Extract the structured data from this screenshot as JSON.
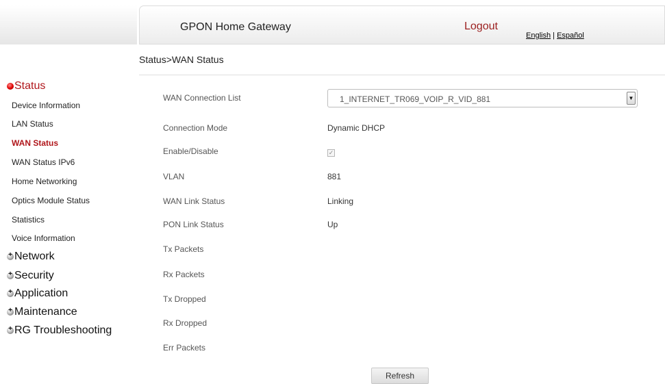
{
  "header": {
    "brand": "GPON Home Gateway",
    "logout": "Logout",
    "lang_english": "English",
    "lang_separator": "|",
    "lang_spanish": "Español"
  },
  "breadcrumb": "Status>WAN Status",
  "sidebar": {
    "status_section": "Status",
    "items": [
      {
        "label": "Device Information"
      },
      {
        "label": "LAN Status"
      },
      {
        "label": "WAN Status",
        "active": true
      },
      {
        "label": "WAN Status IPv6"
      },
      {
        "label": "Home Networking"
      },
      {
        "label": "Optics Module Status"
      },
      {
        "label": "Statistics"
      },
      {
        "label": "Voice Information"
      }
    ],
    "sections": [
      {
        "label": "Network"
      },
      {
        "label": "Security"
      },
      {
        "label": "Application"
      },
      {
        "label": "Maintenance"
      },
      {
        "label": "RG Troubleshooting"
      }
    ]
  },
  "form": {
    "connection_list_label": "WAN Connection List",
    "connection_list_value": "1_INTERNET_TR069_VOIP_R_VID_881",
    "connection_mode_label": "Connection Mode",
    "connection_mode_value": "Dynamic DHCP",
    "enable_label": "Enable/Disable",
    "enable_checked": true,
    "vlan_label": "VLAN",
    "vlan_value": "881",
    "wan_link_label": "WAN Link Status",
    "wan_link_value": "Linking",
    "pon_link_label": "PON Link Status",
    "pon_link_value": "Up",
    "tx_packets_label": "Tx Packets",
    "rx_packets_label": "Rx Packets",
    "tx_dropped_label": "Tx Dropped",
    "rx_dropped_label": "Rx Dropped",
    "err_packets_label": "Err Packets",
    "refresh_label": "Refresh"
  },
  "colors": {
    "accent": "#b0161b",
    "logout": "#9b1e1e"
  },
  "icons": {
    "open_section": "red-dot-icon",
    "closed_section": "expand-plus-icon",
    "dropdown": "chevron-down-icon"
  }
}
